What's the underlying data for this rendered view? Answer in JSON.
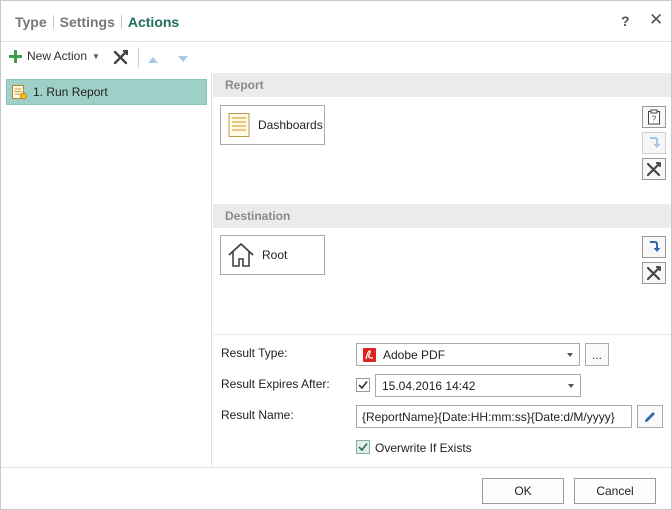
{
  "titlebar": {
    "tabs": [
      {
        "label": "Type"
      },
      {
        "label": "Settings"
      },
      {
        "label": "Actions"
      }
    ],
    "help_label": "?",
    "close_label": "✕"
  },
  "toolbar": {
    "new_action_label": "New Action"
  },
  "actions": [
    {
      "label": "1. Run Report"
    }
  ],
  "report": {
    "header": "Report",
    "item_label": "Dashboards"
  },
  "destination": {
    "header": "Destination",
    "item_label": "Root"
  },
  "form": {
    "result_type_label": "Result Type:",
    "result_type_value": "Adobe PDF",
    "browse_label": "...",
    "result_expires_label": "Result Expires After:",
    "result_expires_value": "15.04.2016 14:42",
    "result_name_label": "Result Name:",
    "result_name_value": "{ReportName}{Date:HH:mm:ss}{Date:d/M/yyyy}",
    "overwrite_label": "Overwrite If Exists"
  },
  "footer": {
    "ok_label": "OK",
    "cancel_label": "Cancel"
  },
  "colors": {
    "active_tab": "#1f6e5e",
    "selected_item_bg": "#9fd0c7",
    "section_header_bg": "#ebebeb",
    "add_icon": "#3aa04a",
    "arrow_blue": "#2a6fb0",
    "pdf_red": "#d22"
  }
}
